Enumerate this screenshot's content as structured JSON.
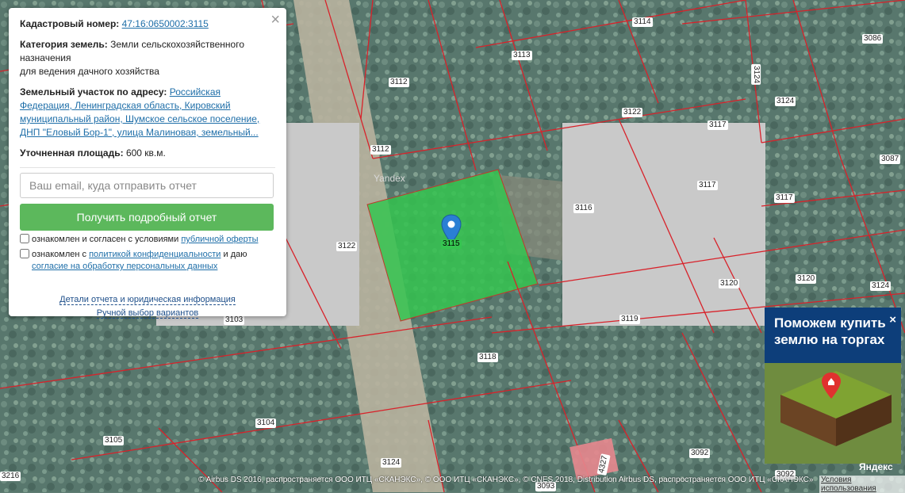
{
  "popup": {
    "cadastral_label": "Кадастровый номер:",
    "cadastral_value": "47:16:0650002:3115",
    "category_label": "Категория земель:",
    "category_value": "Земли сельскохозяйственного назначения",
    "category_value_2": "для ведения дачного хозяйства",
    "address_label": "Земельный участок по адресу:",
    "address_value": "Российская Федерация, Ленинградская область, Кировский муниципальный район, Шумское сельское поселение, ДНП \"Еловый Бор-1\", улица Малиновая, земельный...",
    "area_label": "Уточненная площадь:",
    "area_value": "600 кв.м.",
    "email_placeholder": "Ваш email, куда отправить отчет",
    "report_button": "Получить подробный отчет",
    "agree1_text": "ознакомлен и согласен с условиями ",
    "agree1_link": "публичной оферты",
    "agree2_text": "ознакомлен с ",
    "agree2_link": "политикой конфиденциальности",
    "agree2_text2": " и даю",
    "agree2_link2": "согласие на обработку персональных данных",
    "details_link": "Детали отчета и юридическая информация",
    "manual_link": "Ручной выбор вариантов",
    "close_glyph": "×"
  },
  "map": {
    "selected_plot": "3115",
    "tile_watermark": "Yandex",
    "plots": [
      "3114",
      "3086",
      "3113",
      "3124",
      "3112",
      "3124",
      "3122",
      "3117",
      "3112",
      "3087",
      "3117",
      "3116",
      "3117",
      "3122",
      "3120",
      "3124",
      "3103",
      "3119",
      "3118",
      "3104",
      "3105",
      "3124",
      "4327",
      "3092",
      "3216",
      "3093",
      "3092"
    ]
  },
  "ad": {
    "title": "Поможем купить землю на торгах",
    "close_glyph": "×"
  },
  "footer": {
    "attribution": "© Airbus DS 2016, распространяется ООО ИТЦ «СКАНЭКС», © ООО ИТЦ «СКАНЭКС», © CNES 2018, Distribution Airbus DS, распространяется ООО ИТЦ «СКАНЭКС»",
    "terms": "Условия использования",
    "logo": "Яндекс"
  }
}
